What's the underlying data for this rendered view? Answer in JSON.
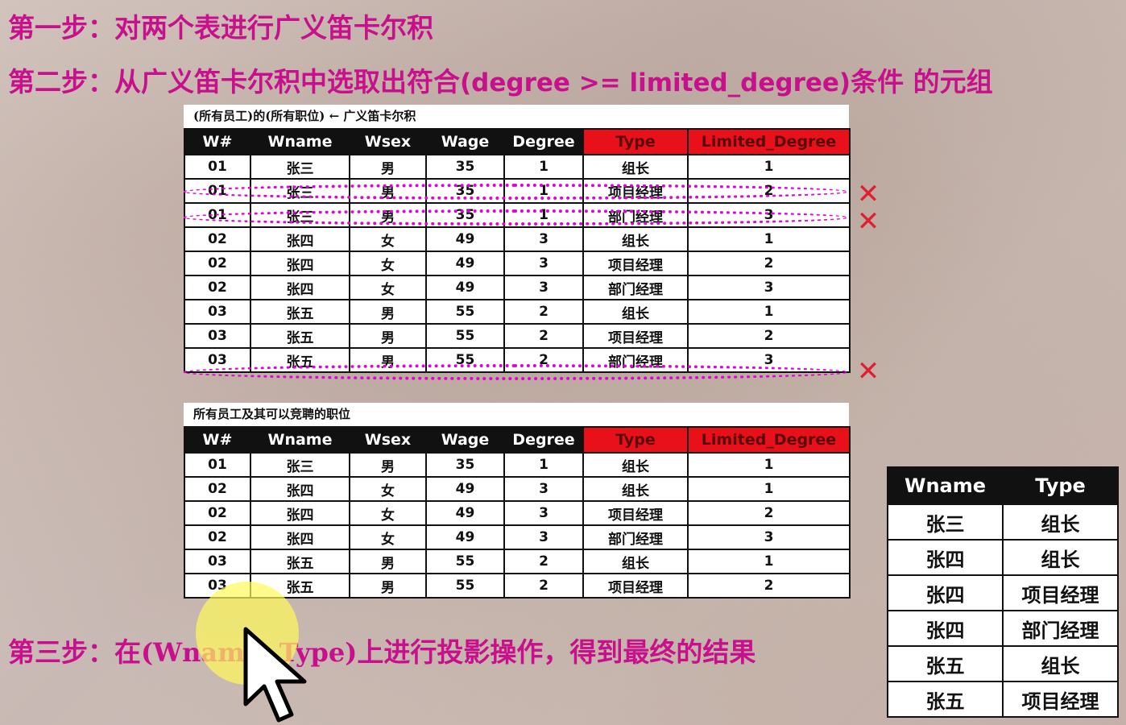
{
  "steps": {
    "step1": "第一步：对两个表进行广义笛卡尔积",
    "step2_prefix": "第二步：从广义笛卡尔积中选取出符合",
    "step2_condition": "(degree >= limited_degree)",
    "step2_suffix": "条件 的元组",
    "step3_prefix": "第三步：在",
    "step3_condition": "(Wname, Type)",
    "step3_suffix": "上进行投影操作，得到最终的结果"
  },
  "table1": {
    "caption": "(所有员工)的(所有职位)  ←  广义笛卡尔积",
    "headers": [
      "W#",
      "Wname",
      "Wsex",
      "Wage",
      "Degree",
      "Type",
      "Limited_Degree"
    ],
    "rows": [
      [
        "01",
        "张三",
        "男",
        "35",
        "1",
        "组长",
        "1"
      ],
      [
        "01",
        "张三",
        "男",
        "35",
        "1",
        "项目经理",
        "2"
      ],
      [
        "01",
        "张三",
        "男",
        "35",
        "1",
        "部门经理",
        "3"
      ],
      [
        "02",
        "张四",
        "女",
        "49",
        "3",
        "组长",
        "1"
      ],
      [
        "02",
        "张四",
        "女",
        "49",
        "3",
        "项目经理",
        "2"
      ],
      [
        "02",
        "张四",
        "女",
        "49",
        "3",
        "部门经理",
        "3"
      ],
      [
        "03",
        "张五",
        "男",
        "55",
        "2",
        "组长",
        "1"
      ],
      [
        "03",
        "张五",
        "男",
        "55",
        "2",
        "项目经理",
        "2"
      ],
      [
        "03",
        "张五",
        "男",
        "55",
        "2",
        "部门经理",
        "3"
      ]
    ]
  },
  "table2": {
    "caption": "所有员工及其可以竞聘的职位",
    "headers": [
      "W#",
      "Wname",
      "Wsex",
      "Wage",
      "Degree",
      "Type",
      "Limited_Degree"
    ],
    "rows": [
      [
        "01",
        "张三",
        "男",
        "35",
        "1",
        "组长",
        "1"
      ],
      [
        "02",
        "张四",
        "女",
        "49",
        "3",
        "组长",
        "1"
      ],
      [
        "02",
        "张四",
        "女",
        "49",
        "3",
        "项目经理",
        "2"
      ],
      [
        "02",
        "张四",
        "女",
        "49",
        "3",
        "部门经理",
        "3"
      ],
      [
        "03",
        "张五",
        "男",
        "55",
        "2",
        "组长",
        "1"
      ],
      [
        "03",
        "张五",
        "男",
        "55",
        "2",
        "项目经理",
        "2"
      ]
    ]
  },
  "result": {
    "headers": [
      "Wname",
      "Type"
    ],
    "rows": [
      [
        "张三",
        "组长"
      ],
      [
        "张四",
        "组长"
      ],
      [
        "张四",
        "项目经理"
      ],
      [
        "张四",
        "部门经理"
      ],
      [
        "张五",
        "组长"
      ],
      [
        "张五",
        "项目经理"
      ]
    ]
  },
  "marks": {
    "x_symbol": "✕"
  },
  "colors": {
    "title": "#c8108c",
    "header_highlight": "#e8111a",
    "strike": "#e400d8",
    "x_mark": "#e02030"
  }
}
